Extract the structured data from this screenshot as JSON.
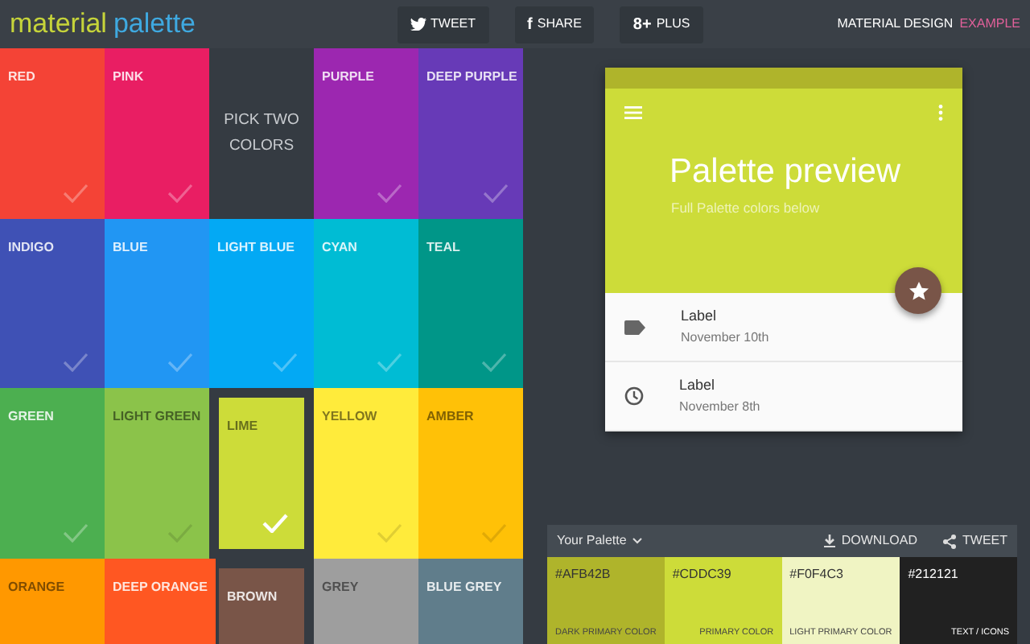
{
  "header": {
    "logo_first": "material",
    "logo_second": "palette",
    "share_buttons": [
      {
        "kind": "twitter",
        "label": "TWEET"
      },
      {
        "kind": "facebook",
        "icon": "f",
        "label": "SHARE"
      },
      {
        "kind": "gplus",
        "icon": "8+",
        "label": "PLUS"
      }
    ],
    "link_first": "MATERIAL DESIGN",
    "link_second": "EXAMPLE"
  },
  "tiles": [
    {
      "kind": "swatch",
      "name": "RED",
      "color": "#f44336",
      "selected": false
    },
    {
      "kind": "swatch",
      "name": "PINK",
      "color": "#e91e63",
      "selected": false
    },
    {
      "kind": "prompt",
      "name": "PICK TWO COLORS"
    },
    {
      "kind": "swatch",
      "name": "PURPLE",
      "color": "#9c27b0",
      "selected": false
    },
    {
      "kind": "swatch",
      "name": "DEEP PURPLE",
      "color": "#673ab7",
      "selected": false
    },
    {
      "kind": "swatch",
      "name": "INDIGO",
      "color": "#3f51b5",
      "selected": false
    },
    {
      "kind": "swatch",
      "name": "BLUE",
      "color": "#2196f3",
      "selected": false
    },
    {
      "kind": "swatch",
      "name": "LIGHT BLUE",
      "color": "#03a9f4",
      "selected": false
    },
    {
      "kind": "swatch",
      "name": "CYAN",
      "color": "#00bcd4",
      "selected": false
    },
    {
      "kind": "swatch",
      "name": "TEAL",
      "color": "#009688",
      "selected": false
    },
    {
      "kind": "swatch",
      "name": "GREEN",
      "color": "#4caf50",
      "selected": false
    },
    {
      "kind": "swatch",
      "name": "LIGHT GREEN",
      "color": "#8bc34a",
      "selected": false
    },
    {
      "kind": "swatch",
      "name": "LIME",
      "color": "#cddc39",
      "selected": true
    },
    {
      "kind": "swatch",
      "name": "YELLOW",
      "color": "#ffeb3b",
      "selected": false
    },
    {
      "kind": "swatch",
      "name": "AMBER",
      "color": "#ffc107",
      "selected": false
    },
    {
      "kind": "swatch",
      "name": "ORANGE",
      "color": "#ff9800",
      "selected": false
    },
    {
      "kind": "swatch",
      "name": "DEEP ORANGE",
      "color": "#ff5722",
      "selected": false
    },
    {
      "kind": "swatch",
      "name": "BROWN",
      "color": "#795548",
      "selected": true
    },
    {
      "kind": "swatch",
      "name": "GREY",
      "color": "#9e9e9e",
      "selected": false
    },
    {
      "kind": "swatch",
      "name": "BLUE GREY",
      "color": "#607d8b",
      "selected": false
    }
  ],
  "preview": {
    "title": "Palette preview",
    "subtitle": "Full Palette colors below",
    "items": [
      {
        "kind": "tag",
        "label": "Label",
        "date": "November 10th"
      },
      {
        "kind": "clock",
        "label": "Label",
        "date": "November 8th"
      }
    ]
  },
  "palette": {
    "title": "Your Palette",
    "actions": [
      {
        "kind": "download",
        "label": "DOWNLOAD"
      },
      {
        "kind": "share",
        "label": "TWEET"
      }
    ],
    "swatches": [
      {
        "hex": "#AFB42B",
        "role": "DARK PRIMARY COLOR",
        "color": "#afb42b"
      },
      {
        "hex": "#CDDC39",
        "role": "PRIMARY COLOR",
        "color": "#cddc39"
      },
      {
        "hex": "#F0F4C3",
        "role": "LIGHT PRIMARY COLOR",
        "color": "#f0f4c3"
      },
      {
        "hex": "#212121",
        "role": "TEXT / ICONS",
        "color": "#212121"
      }
    ]
  }
}
